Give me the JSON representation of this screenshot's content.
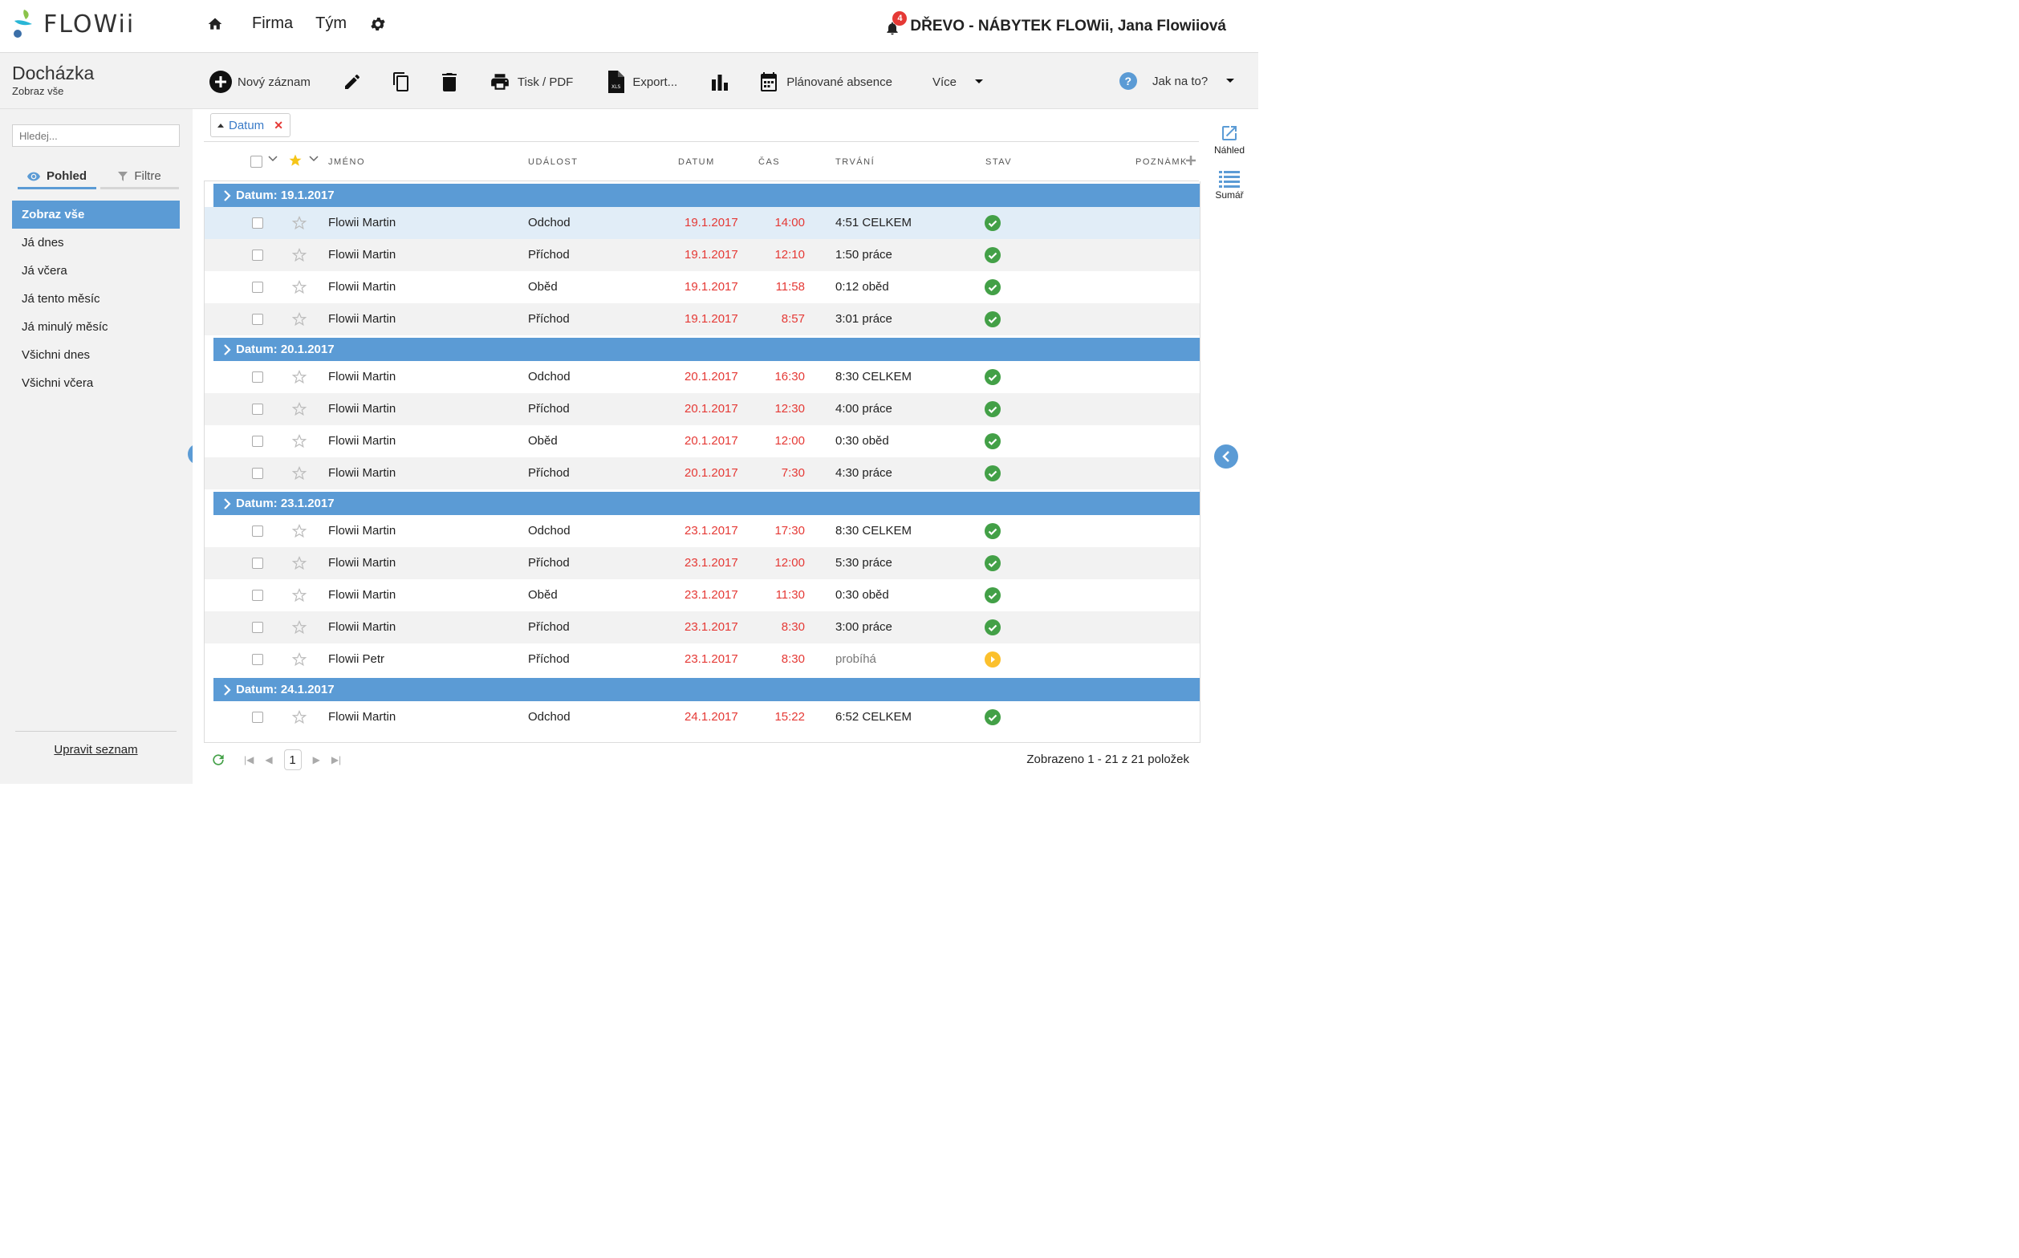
{
  "app": {
    "logo_text": "FLOWii",
    "nav": {
      "firma": "Firma",
      "tym": "Tým"
    },
    "notifications_count": "4",
    "company_user": "DŘEVO - NÁBYTEK FLOWii, Jana Flowiiová",
    "accent_color": "#5b9bd5"
  },
  "page": {
    "title": "Docházka",
    "subtitle": "Zobraz vše"
  },
  "toolbar": {
    "new_record": "Nový záznam",
    "print": "Tisk / PDF",
    "export": "Export...",
    "planned": "Plánované absence",
    "more": "Více",
    "help": "Jak na to?"
  },
  "sidebar": {
    "search_placeholder": "Hledej...",
    "tab_view": "Pohled",
    "tab_filter": "Filtre",
    "items": [
      "Zobraz vše",
      "Já dnes",
      "Já včera",
      "Já tento měsíc",
      "Já minulý měsíc",
      "Všichni dnes",
      "Všichni včera"
    ],
    "edit_list": "Upravit seznam"
  },
  "filter_chip": "Datum",
  "columns": {
    "name": "JMÉNO",
    "event": "UDÁLOST",
    "date": "DATUM",
    "time": "ČAS",
    "duration": "TRVÁNÍ",
    "status": "STAV",
    "note": "POZNÁMKA"
  },
  "groups": [
    {
      "label": "Datum: 19.1.2017",
      "rows": [
        {
          "name": "Flowii Martin",
          "event": "Odchod",
          "date": "19.1.2017",
          "time": "14:00",
          "duration": "4:51 CELKEM",
          "status": "ok"
        },
        {
          "name": "Flowii Martin",
          "event": "Příchod",
          "date": "19.1.2017",
          "time": "12:10",
          "duration": "1:50 práce",
          "status": "ok"
        },
        {
          "name": "Flowii Martin",
          "event": "Oběd",
          "date": "19.1.2017",
          "time": "11:58",
          "duration": "0:12 oběd",
          "status": "ok"
        },
        {
          "name": "Flowii Martin",
          "event": "Příchod",
          "date": "19.1.2017",
          "time": "8:57",
          "duration": "3:01 práce",
          "status": "ok"
        }
      ]
    },
    {
      "label": "Datum: 20.1.2017",
      "rows": [
        {
          "name": "Flowii Martin",
          "event": "Odchod",
          "date": "20.1.2017",
          "time": "16:30",
          "duration": "8:30 CELKEM",
          "status": "ok"
        },
        {
          "name": "Flowii Martin",
          "event": "Příchod",
          "date": "20.1.2017",
          "time": "12:30",
          "duration": "4:00 práce",
          "status": "ok"
        },
        {
          "name": "Flowii Martin",
          "event": "Oběd",
          "date": "20.1.2017",
          "time": "12:00",
          "duration": "0:30 oběd",
          "status": "ok"
        },
        {
          "name": "Flowii Martin",
          "event": "Příchod",
          "date": "20.1.2017",
          "time": "7:30",
          "duration": "4:30 práce",
          "status": "ok"
        }
      ]
    },
    {
      "label": "Datum: 23.1.2017",
      "rows": [
        {
          "name": "Flowii Martin",
          "event": "Odchod",
          "date": "23.1.2017",
          "time": "17:30",
          "duration": "8:30 CELKEM",
          "status": "ok"
        },
        {
          "name": "Flowii Martin",
          "event": "Příchod",
          "date": "23.1.2017",
          "time": "12:00",
          "duration": "5:30 práce",
          "status": "ok"
        },
        {
          "name": "Flowii Martin",
          "event": "Oběd",
          "date": "23.1.2017",
          "time": "11:30",
          "duration": "0:30 oběd",
          "status": "ok"
        },
        {
          "name": "Flowii Martin",
          "event": "Příchod",
          "date": "23.1.2017",
          "time": "8:30",
          "duration": "3:00 práce",
          "status": "ok"
        },
        {
          "name": "Flowii Petr",
          "event": "Příchod",
          "date": "23.1.2017",
          "time": "8:30",
          "duration": "probíhá",
          "status": "running"
        }
      ]
    },
    {
      "label": "Datum: 24.1.2017",
      "rows": [
        {
          "name": "Flowii Martin",
          "event": "Odchod",
          "date": "24.1.2017",
          "time": "15:22",
          "duration": "6:52 CELKEM",
          "status": "ok"
        }
      ]
    }
  ],
  "pager": {
    "page": "1",
    "summary": "Zobrazeno 1 - 21 z 21 položek"
  },
  "rightbar": {
    "preview": "Náhled",
    "summary": "Sumář"
  }
}
